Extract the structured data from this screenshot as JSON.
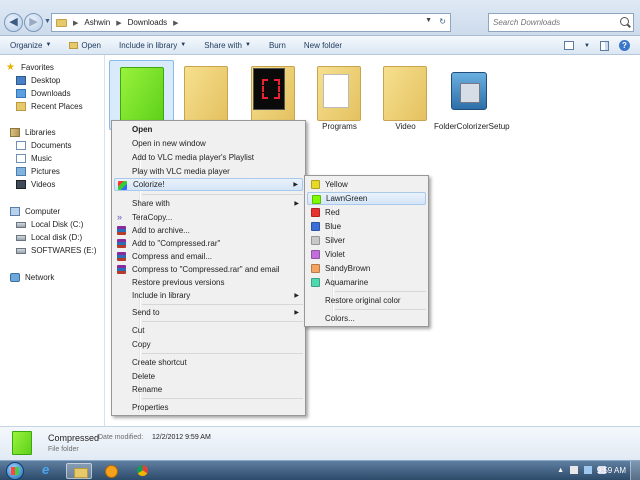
{
  "address": {
    "breadcrumb": [
      "Ashwin",
      "Downloads"
    ],
    "search_placeholder": "Search Downloads"
  },
  "toolbar": {
    "organize": "Organize",
    "open": "Open",
    "include_in_library": "Include in library",
    "share_with": "Share with",
    "burn": "Burn",
    "new_folder": "New folder"
  },
  "navpane": {
    "favorites": "Favorites",
    "desktop": "Desktop",
    "downloads": "Downloads",
    "recent_places": "Recent Places",
    "libraries": "Libraries",
    "documents": "Documents",
    "music": "Music",
    "pictures": "Pictures",
    "videos": "Videos",
    "computer": "Computer",
    "local_c": "Local Disk (C:)",
    "local_d": "Local disk (D:)",
    "softwares_e": "SOFTWARES (E:)",
    "network": "Network"
  },
  "files": {
    "programs": "Programs",
    "video": "Video",
    "setup": "FolderColorizerSetup"
  },
  "context_menu": {
    "open": "Open",
    "open_new_window": "Open in new window",
    "vlc_add": "Add to VLC media player's Playlist",
    "vlc_play": "Play with VLC media player",
    "colorize": "Colorize!",
    "share_with": "Share with",
    "teracopy": "TeraCopy...",
    "add_archive": "Add to archive...",
    "add_rar": "Add to \"Compressed.rar\"",
    "compress_email": "Compress and email...",
    "compress_rar_email": "Compress to \"Compressed.rar\" and email",
    "restore_prev": "Restore previous versions",
    "include_library": "Include in library",
    "send_to": "Send to",
    "cut": "Cut",
    "copy": "Copy",
    "create_shortcut": "Create shortcut",
    "delete": "Delete",
    "rename": "Rename",
    "properties": "Properties"
  },
  "colorize_menu": {
    "yellow": "Yellow",
    "lawngreen": "LawnGreen",
    "red": "Red",
    "blue": "Blue",
    "silver": "Silver",
    "violet": "Violet",
    "sandybrown": "SandyBrown",
    "aquamarine": "Aquamarine",
    "restore": "Restore original color",
    "colors": "Colors..."
  },
  "colors": {
    "yellow": "#e8d82a",
    "lawngreen": "#7cfc00",
    "red": "#e83030",
    "blue": "#3a6fd8",
    "silver": "#c8c8c8",
    "violet": "#c070d8",
    "sandybrown": "#f4a460",
    "aquamarine": "#4fd8b0"
  },
  "details": {
    "name": "Compressed",
    "modified_label": "Date modified:",
    "modified_value": "12/2/2012 9:59 AM",
    "type": "File folder"
  },
  "taskbar": {
    "clock": "9:59 AM"
  }
}
